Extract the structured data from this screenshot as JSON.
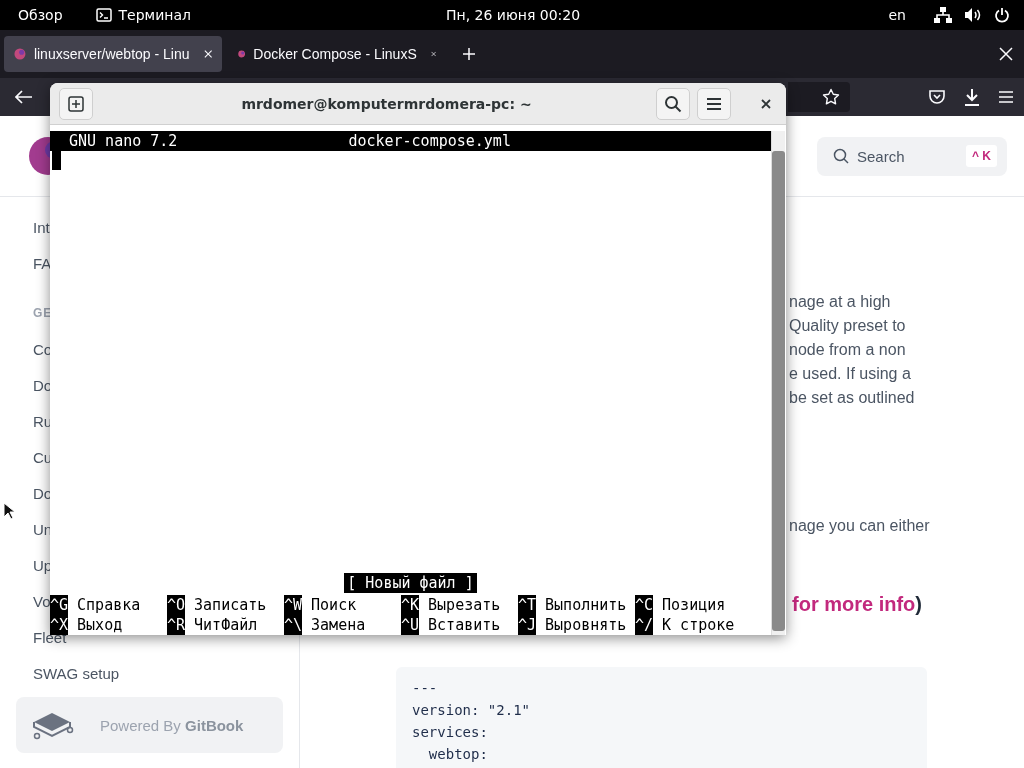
{
  "top_bar": {
    "activities": "Обзор",
    "app": "Терминал",
    "clock": "Пн, 26 июня  00:20",
    "keyboard": "en"
  },
  "browser": {
    "tabs": [
      {
        "title": "linuxserver/webtop - Linu",
        "selected": true
      },
      {
        "title": "Docker Compose - LinuxS",
        "selected": false
      }
    ]
  },
  "page": {
    "search": {
      "placeholder": "Search",
      "shortcut": "^ K"
    },
    "sidebar": {
      "items": [
        {
          "label": "Int",
          "kind": "link"
        },
        {
          "label": "FA",
          "kind": "link"
        },
        {
          "label": "GE",
          "kind": "heading"
        },
        {
          "label": "Co",
          "kind": "link"
        },
        {
          "label": "Do",
          "kind": "link"
        },
        {
          "label": "Ru",
          "kind": "link"
        },
        {
          "label": "Cu",
          "kind": "link"
        },
        {
          "label": "Do",
          "kind": "link"
        },
        {
          "label": "Un",
          "kind": "link"
        },
        {
          "label": "Up",
          "kind": "link"
        },
        {
          "label": "Vo",
          "kind": "link"
        },
        {
          "label": "Fleet",
          "kind": "link"
        },
        {
          "label": "SWAG setup",
          "kind": "link"
        }
      ],
      "footer": {
        "prefix": "Powered By ",
        "brand": "GitBook"
      }
    },
    "paragraph_lines": [
      "nage at a high",
      "Quality preset to",
      "node from a non",
      "e used. If using a",
      "be set as outlined"
    ],
    "paragraph2_lines": [
      "nage you can either"
    ],
    "link_line": {
      "link": "for more info",
      "tail": ")"
    },
    "code_lines": [
      "---",
      "version: \"2.1\"",
      "services:",
      "  webtop:"
    ]
  },
  "terminal": {
    "title": "mrdomer@komputermrdomera-pc: ~",
    "editor": {
      "version": "GNU nano 7.2",
      "filename": "docker-compose.yml",
      "status": "[ Новый файл ]",
      "shortcuts": [
        [
          {
            "key": "^G",
            "label": "Справка"
          },
          {
            "key": "^O",
            "label": "Записать"
          },
          {
            "key": "^W",
            "label": "Поиск"
          },
          {
            "key": "^K",
            "label": "Вырезать"
          },
          {
            "key": "^T",
            "label": "Выполнить"
          },
          {
            "key": "^C",
            "label": "Позиция"
          }
        ],
        [
          {
            "key": "^X",
            "label": "Выход"
          },
          {
            "key": "^R",
            "label": "ЧитФайл"
          },
          {
            "key": "^\\",
            "label": "Замена"
          },
          {
            "key": "^U",
            "label": "Вставить"
          },
          {
            "key": "^J",
            "label": "Выровнять"
          },
          {
            "key": "^/",
            "label": "К строке"
          }
        ]
      ]
    }
  }
}
